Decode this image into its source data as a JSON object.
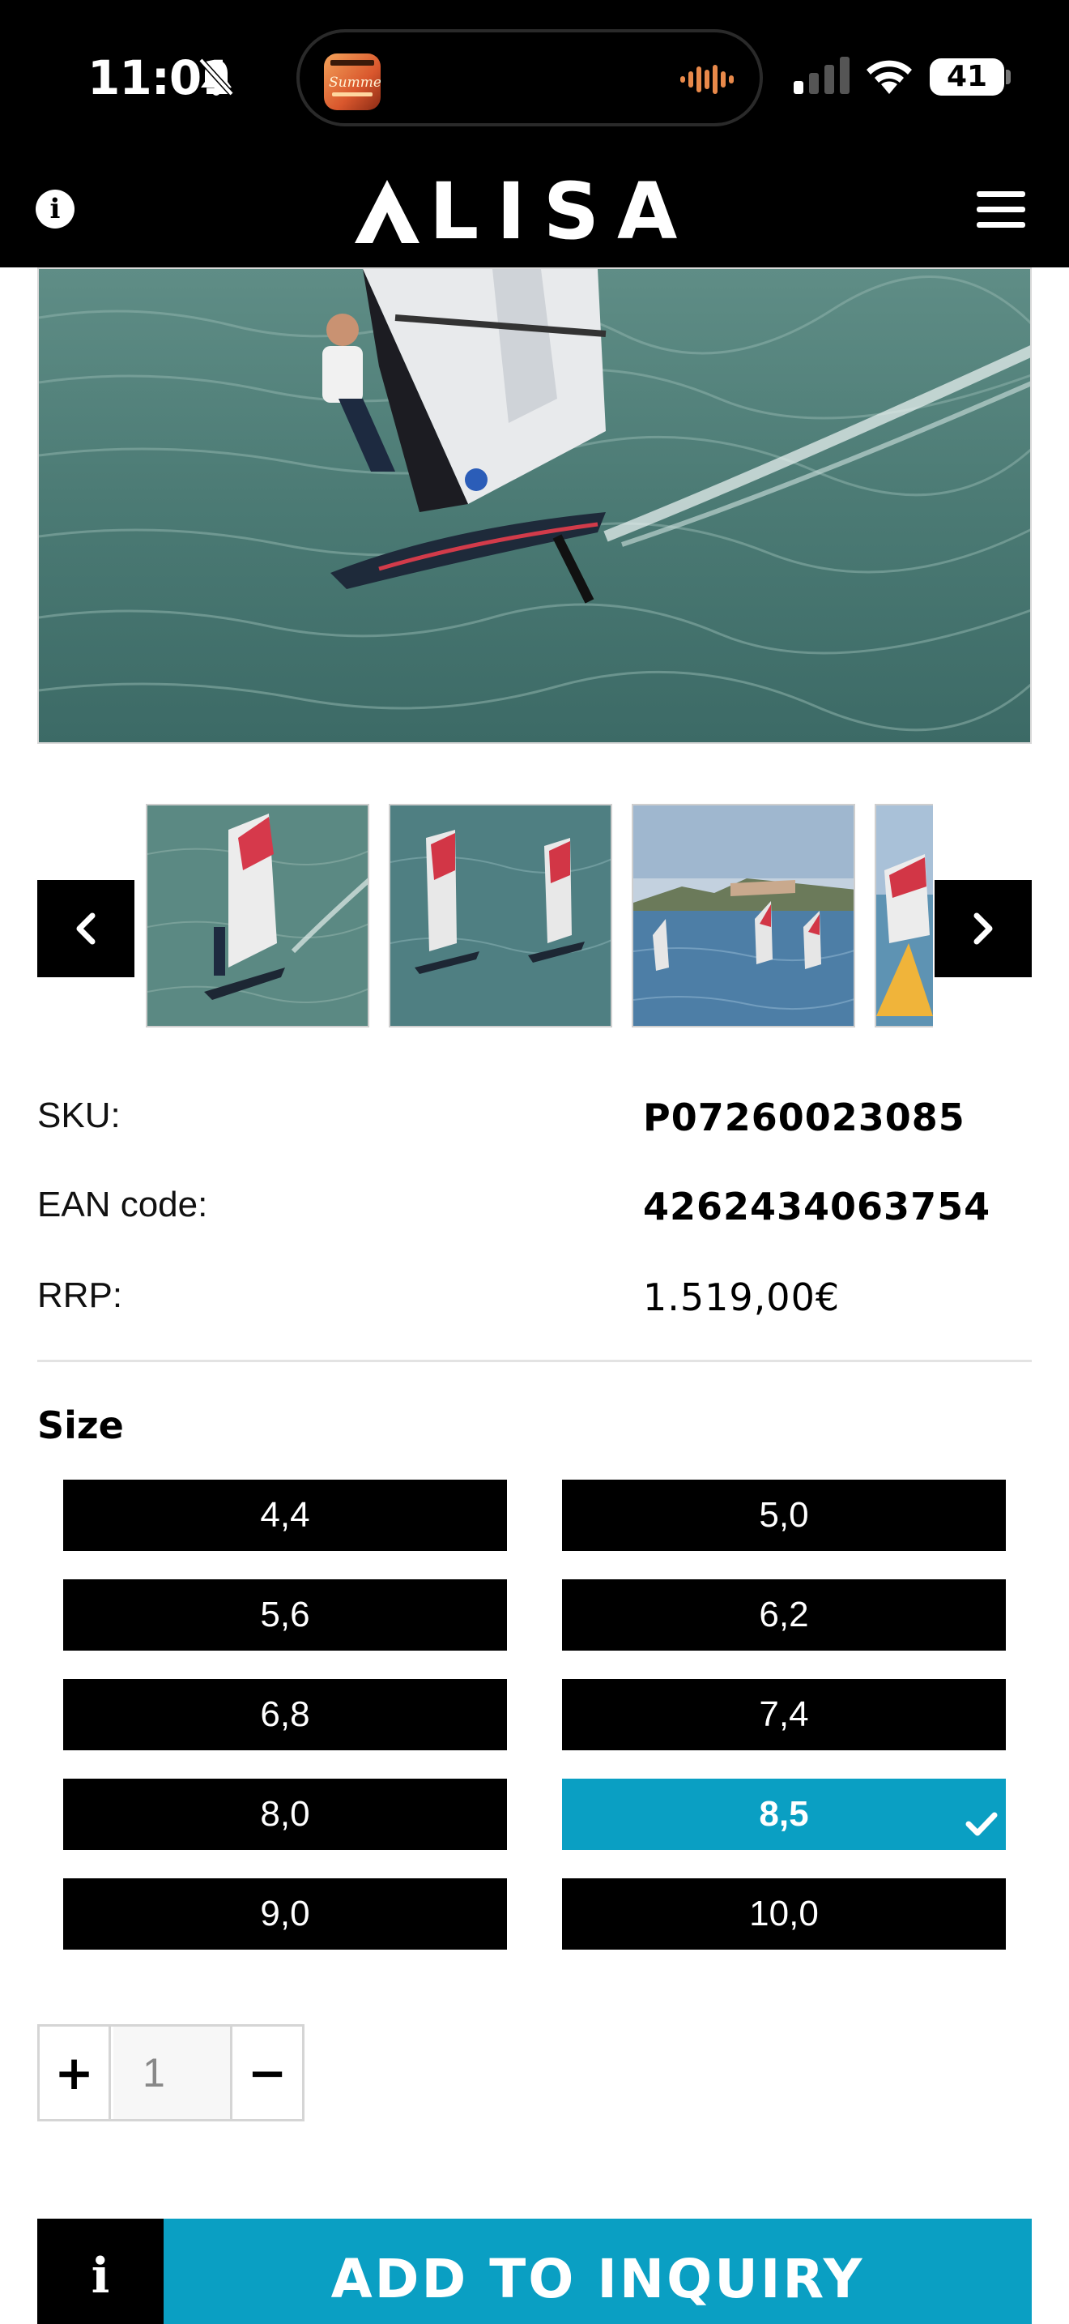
{
  "status_bar": {
    "time": "11:01",
    "battery": "41",
    "island_app_text": "Summer"
  },
  "header": {
    "logo_text": "LISA",
    "info_icon": "i"
  },
  "product": {
    "specs": [
      {
        "label": "SKU:",
        "value": "P07260023085"
      },
      {
        "label": "EAN code:",
        "value": "4262434063754"
      },
      {
        "label": "RRP:",
        "value": "1.519,00€"
      }
    ]
  },
  "size": {
    "title": "Size",
    "options": [
      "4,4",
      "5,0",
      "5,6",
      "6,2",
      "6,8",
      "7,4",
      "8,0",
      "8,5",
      "9,0",
      "10,0"
    ],
    "selected": "8,5"
  },
  "quantity": {
    "plus": "+",
    "value": "1",
    "minus": "−"
  },
  "inquiry": {
    "info_label": "i",
    "button_label": "ADD TO INQUIRY"
  },
  "colors": {
    "accent": "#0a9fc3",
    "header_bg": "#000000",
    "button_bg": "#000000"
  }
}
